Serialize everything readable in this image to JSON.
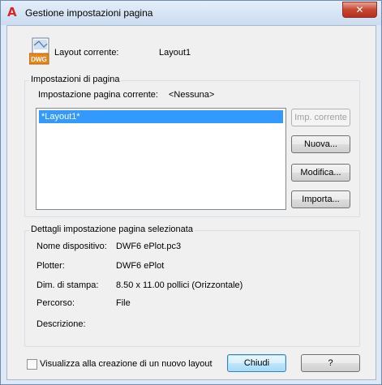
{
  "window": {
    "title": "Gestione impostazioni pagina",
    "app_icon_glyph": "A",
    "close_glyph": "✕"
  },
  "current_layout": {
    "label": "Layout corrente:",
    "value": "Layout1",
    "icon_text": "DWG"
  },
  "page_setups": {
    "group_title": "Impostazioni di pagina",
    "current_label": "Impostazione pagina corrente:",
    "current_value": "<Nessuna>",
    "items": [
      "*Layout1*"
    ],
    "buttons": {
      "set_current": "Imp. corrente",
      "new": "Nuova...",
      "modify": "Modifica...",
      "import": "Importa..."
    }
  },
  "details": {
    "group_title": "Dettagli impostazione pagina selezionata",
    "rows": [
      {
        "label": "Nome dispositivo:",
        "value": "DWF6 ePlot.pc3"
      },
      {
        "label": "Plotter:",
        "value": "DWF6 ePlot"
      },
      {
        "label": "Dim. di stampa:",
        "value": "8.50 x 11.00 pollici (Orizzontale)"
      },
      {
        "label": "Percorso:",
        "value": "File"
      },
      {
        "label": "Descrizione:",
        "value": ""
      }
    ]
  },
  "footer": {
    "checkbox_label": "Visualizza alla creazione di un nuovo layout",
    "checkbox_checked": false,
    "close_button": "Chiudi",
    "help_button": "?"
  },
  "colors": {
    "selection": "#3399ff",
    "accent_red": "#d12a2a"
  }
}
